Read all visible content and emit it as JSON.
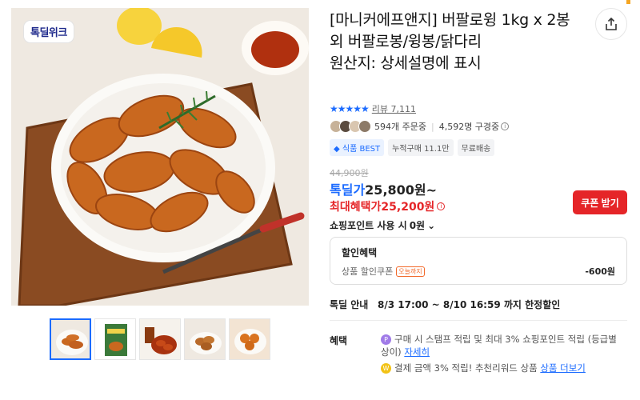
{
  "product": {
    "brand_badge": "톡딜위크",
    "title": "[마니커에프앤지] 버팔로윙 1kg x 2봉 외 버팔로봉/윙봉/닭다리",
    "origin": "원산지: 상세설명에 표시",
    "stars": "★★★★★",
    "review_label": "리뷰 7,111",
    "orders": "594개 주문중",
    "subscribers": "4,592명 구경중"
  },
  "tags": [
    "식품 BEST",
    "누적구매 11.1만",
    "무료배송"
  ],
  "price": {
    "original": "44,900원",
    "tokdeal_label": "톡딜가",
    "tokdeal_value": "25,800원~",
    "max_label": "최대혜택가",
    "max_value": "25,200원",
    "coupon_button": "쿠폰 받기",
    "points_label": "쇼핑포인트 사용 시",
    "points_value": "0원"
  },
  "discount": {
    "title": "할인혜택",
    "item_label": "상품 할인쿠폰",
    "item_badge": "오늘까지",
    "item_amount": "-600원"
  },
  "deal": {
    "label": "톡딜 안내",
    "period": "8/3 17:00 ~ 8/10 16:59 까지 한정할인"
  },
  "benefit": {
    "label": "혜택",
    "line1": "구매 시 스탬프 적립 및 최대 3% 쇼핑포인트 적립 (등급별 상이)",
    "line1_link": "자세히",
    "line2": "결제 금액 3% 적립! 추천리워드 상품",
    "line2_link": "상품 더보기",
    "coin1": "P",
    "coin2": "W"
  },
  "icons": {
    "share": "share-icon",
    "info": "info-icon"
  },
  "colors": {
    "accent_blue": "#1b6bff",
    "accent_red": "#e52528"
  }
}
